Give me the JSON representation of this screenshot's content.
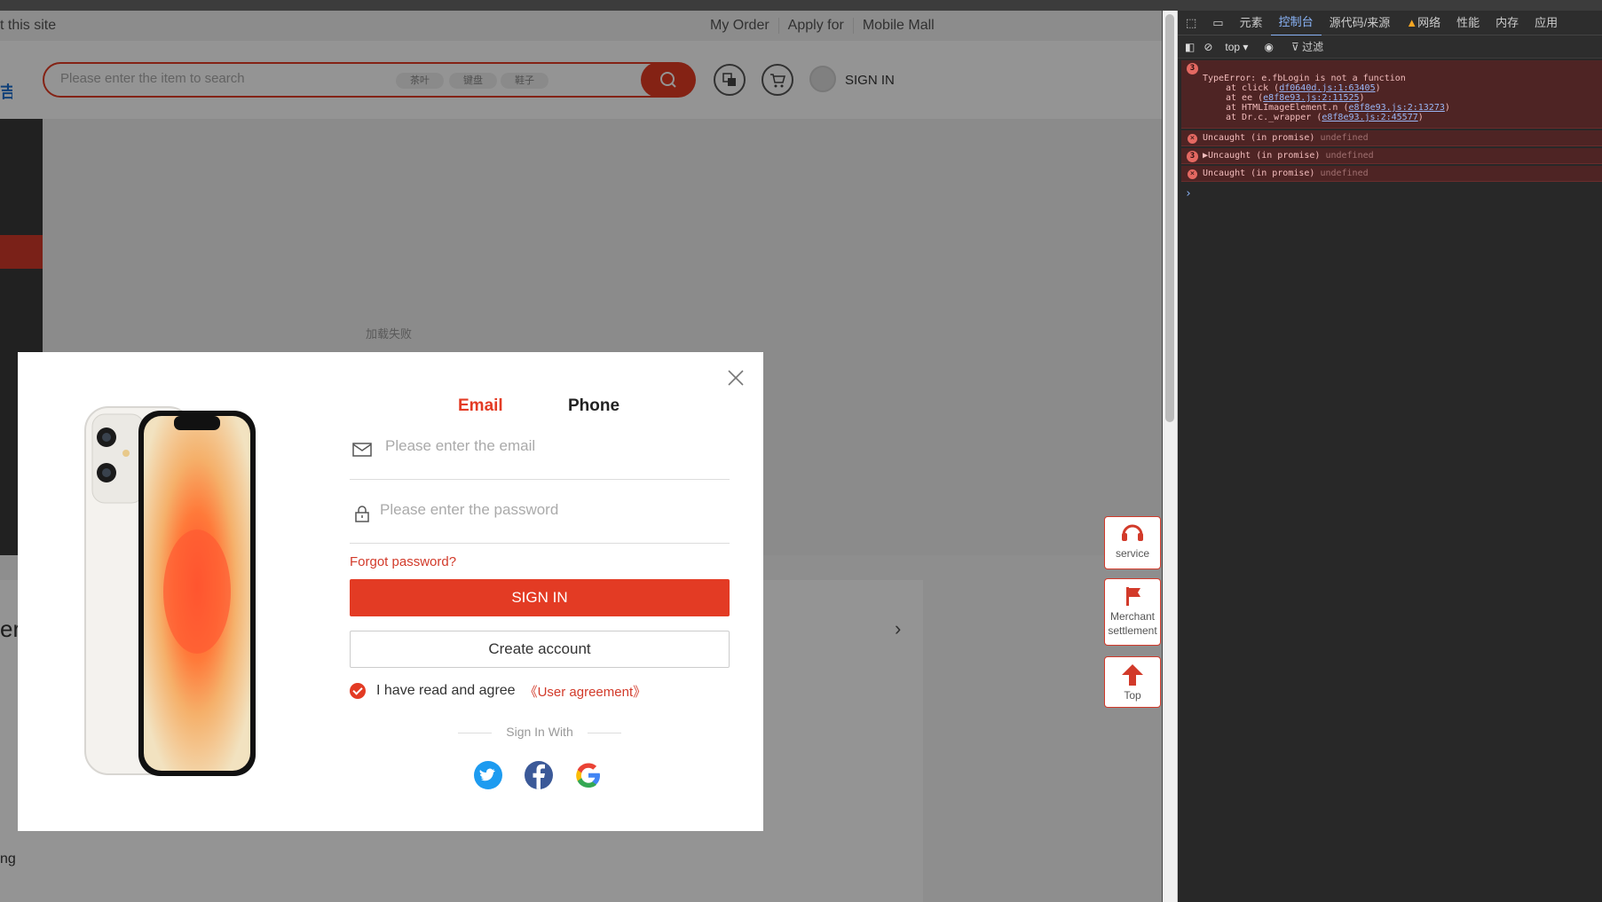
{
  "page": {
    "topbar_left": "t this site",
    "topbar_links": [
      "My Order",
      "Apply for",
      "Mobile Mall"
    ],
    "search_placeholder": "Please enter the item to search",
    "search_tags": [
      "茶叶",
      "键盘",
      "鞋子"
    ],
    "signin_link": "SIGN IN",
    "load_failed": "加载失败",
    "fragment_left": "er",
    "fragment_bottom": "ng"
  },
  "float_buttons": {
    "service": "service",
    "merchant": "Merchant settlement",
    "top": "Top"
  },
  "modal": {
    "tab_email": "Email",
    "tab_phone": "Phone",
    "email_placeholder": "Please enter the email",
    "password_placeholder": "Please enter the password",
    "forgot_password": "Forgot password?",
    "signin_button": "SIGN IN",
    "create_account_button": "Create account",
    "agree_text": "I have read and agree",
    "user_agreement": "《User agreement》",
    "sign_in_with": "Sign In With",
    "social": [
      "twitter-icon",
      "facebook-icon",
      "google-icon"
    ]
  },
  "devtools": {
    "tabs": [
      "元素",
      "控制台",
      "源代码/来源",
      "网络",
      "性能",
      "内存",
      "应用"
    ],
    "active_tab": "控制台",
    "context": "top",
    "filter": "过滤",
    "errors": [
      {
        "count": "3",
        "message": "TypeError: e.fbLogin is not a function",
        "stack": [
          {
            "text": "at click (",
            "link": "df0640d.js:1:63405",
            "end": ")"
          },
          {
            "text": "at ee (",
            "link": "e8f8e93.js:2:11525",
            "end": ")"
          },
          {
            "text": "at HTMLImageElement.n (",
            "link": "e8f8e93.js:2:13273",
            "end": ")"
          },
          {
            "text": "at Dr.c._wrapper (",
            "link": "e8f8e93.js:2:45577",
            "end": ")"
          }
        ]
      },
      {
        "count": "",
        "message": "Uncaught (in promise)",
        "detail": "undefined"
      },
      {
        "count": "3",
        "message": "▶Uncaught (in promise)",
        "detail": "undefined"
      },
      {
        "count": "",
        "message": "Uncaught (in promise)",
        "detail": "undefined"
      }
    ],
    "prompt": "›"
  },
  "colors": {
    "accent": "#e33b24",
    "devtools_bg": "#282828",
    "error_bg": "#4e2424"
  }
}
